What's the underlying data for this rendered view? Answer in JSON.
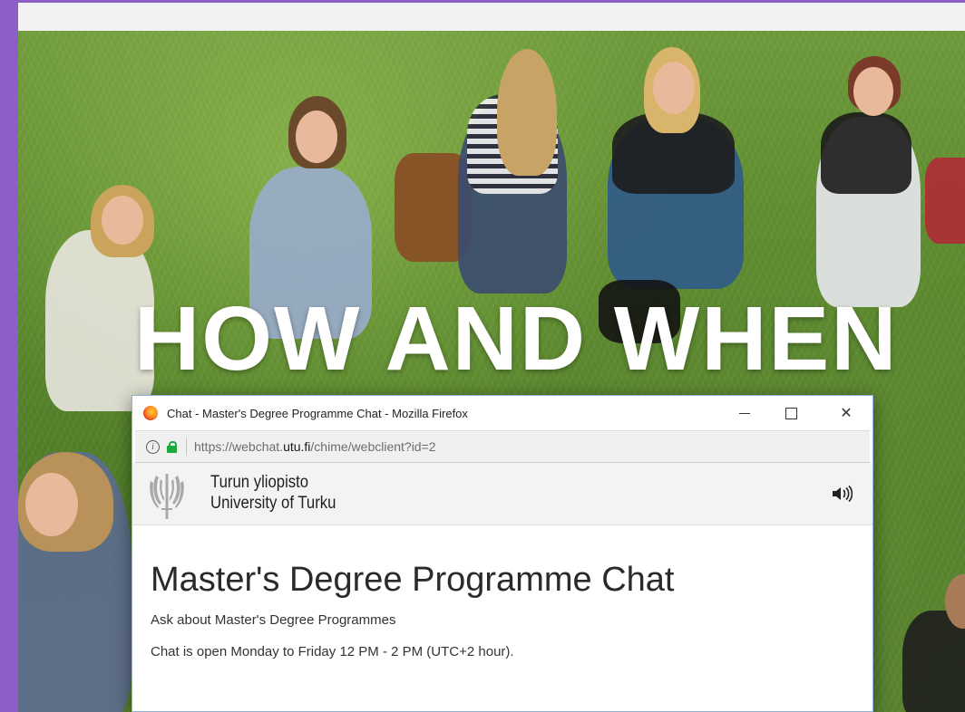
{
  "hero": {
    "title": "HOW AND WHEN"
  },
  "popup": {
    "window_title": "Chat - Master's Degree Programme Chat - Mozilla Firefox",
    "url_prefix": "https://webchat.",
    "url_domain": "utu.fi",
    "url_path": "/chime/webclient?id=2",
    "window_controls": {
      "minimize": "—",
      "maximize": "☐",
      "close": "✕"
    }
  },
  "chat": {
    "org_name_fi": "Turun yliopisto",
    "org_name_en": "University of Turku",
    "title": "Master's Degree Programme Chat",
    "subtitle": "Ask about Master's Degree Programmes",
    "hours": "Chat is open Monday to Friday 12 PM - 2 PM (UTC+2 hour)."
  },
  "icons": {
    "browser": "firefox-icon",
    "info": "info-icon",
    "secure": "lock-icon",
    "sound": "speaker-icon",
    "logo": "university-logo-icon"
  },
  "colors": {
    "frame": "#8c5fc8",
    "lock": "#1aaa3c",
    "hero_text": "#ffffff"
  }
}
